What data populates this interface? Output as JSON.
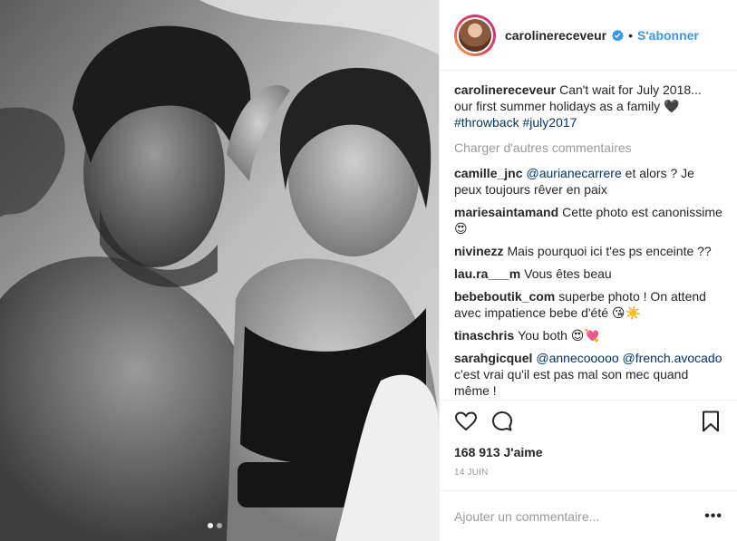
{
  "post": {
    "username": "carolinereceveur",
    "separator": "•",
    "follow_label": "S'abonner",
    "caption": {
      "username": "carolinereceveur",
      "text": "Can't wait for July 2018... our first summer holidays as a family 🖤",
      "hashtags": [
        "#throwback",
        "#july2017"
      ]
    },
    "load_more_label": "Charger d'autres commentaires",
    "comments": [
      {
        "username": "camille_jnc",
        "mention": "@aurianecarrere",
        "text": " et alors ? Je peux toujours rêver en paix"
      },
      {
        "username": "mariesaintamand",
        "mention": "",
        "text": "Cette photo est canonissime 😍"
      },
      {
        "username": "nivinezz",
        "mention": "",
        "text": "Mais pourquoi ici t'es ps enceinte ??"
      },
      {
        "username": "lau.ra___m",
        "mention": "",
        "text": "Vous êtes beau"
      },
      {
        "username": "bebeboutik_com",
        "mention": "",
        "text": "superbe photo ! On attend avec impatience bebe d'été 😘☀️"
      },
      {
        "username": "tinaschris",
        "mention": "",
        "text": "You both 😍💘"
      },
      {
        "username": "sarahgicquel",
        "mention": "@annecooooo @french.avocado",
        "text": " c'est vrai qu'il est pas mal son mec quand même !"
      }
    ],
    "likes_label": "168 913 J'aime",
    "date_label": "14 JUIN",
    "add_comment_placeholder": "Ajouter un commentaire...",
    "more_label": "•••",
    "carousel": {
      "count": 2,
      "active_index": 1
    },
    "colors": {
      "accent": "#3897f0",
      "text": "#262626",
      "muted": "#999999",
      "hashtag": "#003569"
    },
    "icons": [
      "heart-icon",
      "comment-icon",
      "bookmark-icon",
      "verified-badge-icon",
      "more-icon"
    ]
  }
}
